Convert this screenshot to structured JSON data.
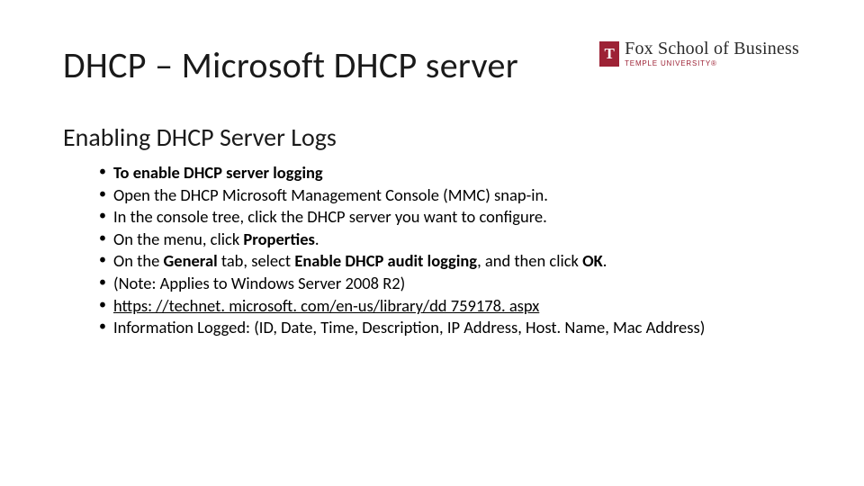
{
  "logo": {
    "main": "Fox School of Business",
    "sub": "TEMPLE UNIVERSITY®"
  },
  "title": "DHCP – Microsoft DHCP server",
  "subtitle": "Enabling DHCP Server Logs",
  "bullets": [
    {
      "segments": [
        {
          "text": "To enable DHCP server logging",
          "bold": true
        }
      ]
    },
    {
      "segments": [
        {
          "text": "Open the DHCP Microsoft Management Console (MMC) snap-in."
        }
      ]
    },
    {
      "segments": [
        {
          "text": "In the console tree, click the DHCP server you want to configure."
        }
      ]
    },
    {
      "segments": [
        {
          "text": "On the menu, click "
        },
        {
          "text": "Properties",
          "bold": true
        },
        {
          "text": "."
        }
      ]
    },
    {
      "segments": [
        {
          "text": "On the "
        },
        {
          "text": "General",
          "bold": true
        },
        {
          "text": " tab, select "
        },
        {
          "text": "Enable DHCP audit logging",
          "bold": true
        },
        {
          "text": ", and then click "
        },
        {
          "text": "OK",
          "bold": true
        },
        {
          "text": "."
        }
      ]
    },
    {
      "segments": [
        {
          "text": "(Note:  Applies to Windows Server 2008 R2)"
        }
      ]
    },
    {
      "segments": [
        {
          "text": "https: //technet. microsoft. com/en-us/library/dd 759178. aspx",
          "underline": true
        }
      ]
    },
    {
      "segments": [
        {
          "text": "Information Logged: (ID, Date, Time, Description, IP Address, Host. Name, Mac Address)"
        }
      ]
    }
  ]
}
